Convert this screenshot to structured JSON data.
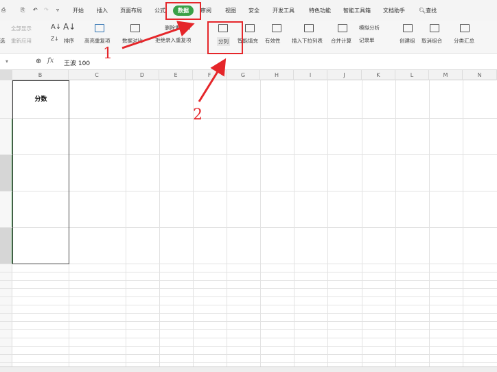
{
  "quick_toolbar": {
    "icons": [
      "print-icon",
      "print-preview-icon",
      "undo-icon",
      "redo-icon",
      "dropdown-icon"
    ]
  },
  "menu_tabs": [
    "开始",
    "插入",
    "页面布局",
    "公式",
    "数据",
    "审阅",
    "视图",
    "安全",
    "开发工具",
    "特色功能",
    "智能工具箱",
    "文档助手"
  ],
  "active_tab": "数据",
  "search_label": "查找",
  "ribbon": {
    "show_all": "全部显示",
    "reapply": "重新应用",
    "filter_partial": "选",
    "sort": "排序",
    "highlight_dup": "高亮重复项",
    "data_compare": "数据对比",
    "remove_dup": "删除重复项",
    "reject_dup": "拒绝录入重复项",
    "split_column": "分列",
    "smart_fill": "智能填充",
    "validity": "有效性",
    "insert_dropdown": "插入下拉列表",
    "consolidate": "合并计算",
    "simulate": "模拟分析",
    "record_form": "记录单",
    "create_group": "创建组",
    "ungroup": "取消组合",
    "subtotal": "分类汇总"
  },
  "formula_bar": {
    "fx": "fx",
    "value": "王波 100"
  },
  "columns": [
    "B",
    "C",
    "D",
    "E",
    "F",
    "G",
    "H",
    "I",
    "J",
    "K",
    "L",
    "M",
    "N"
  ],
  "cells": {
    "B_header": "分数"
  },
  "annotations": {
    "step1": "1",
    "step2": "2",
    "color": "#e5262a"
  }
}
